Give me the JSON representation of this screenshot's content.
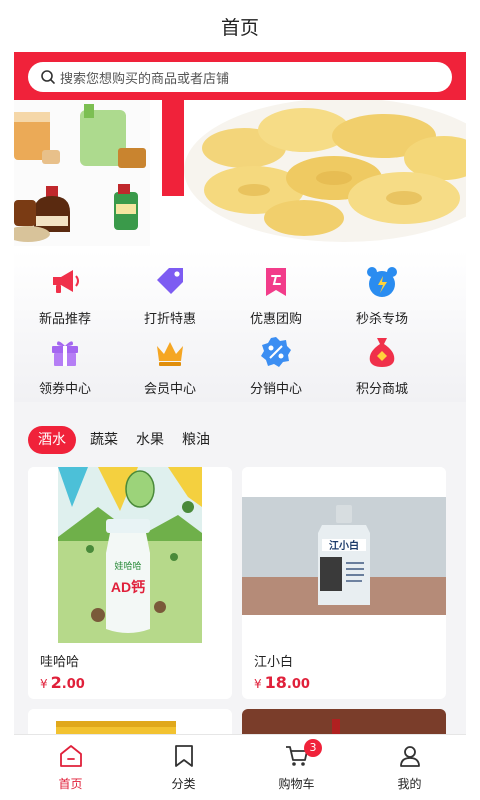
{
  "header": {
    "title": "首页"
  },
  "search": {
    "placeholder": "搜索您想购买的商品或者店铺"
  },
  "menu": [
    {
      "label": "新品推荐",
      "icon": "megaphone-icon",
      "color": "#f0304a"
    },
    {
      "label": "打折特惠",
      "icon": "price-tag-icon",
      "color": "#7d5cf2"
    },
    {
      "label": "优惠团购",
      "icon": "group-buy-icon",
      "color": "#f23c8a"
    },
    {
      "label": "秒杀专场",
      "icon": "alarm-clock-icon",
      "color": "#2a8cf0"
    },
    {
      "label": "领券中心",
      "icon": "gift-icon",
      "color": "#a466f0"
    },
    {
      "label": "会员中心",
      "icon": "crown-icon",
      "color": "#f5a623"
    },
    {
      "label": "分销中心",
      "icon": "discount-icon",
      "color": "#3c8ef2"
    },
    {
      "label": "积分商城",
      "icon": "money-bag-icon",
      "color": "#f0304a"
    }
  ],
  "category_tabs": [
    {
      "label": "酒水",
      "active": true
    },
    {
      "label": "蔬菜",
      "active": false
    },
    {
      "label": "水果",
      "active": false
    },
    {
      "label": "粮油",
      "active": false
    }
  ],
  "products": [
    {
      "name": "哇哈哈",
      "currency": "¥",
      "price_int": "2",
      "price_dec": ".00",
      "image_text": "娃哈哈",
      "image_label": "AD钙"
    },
    {
      "name": "江小白",
      "currency": "¥",
      "price_int": "18",
      "price_dec": ".00",
      "image_text": "江小白",
      "image_label": ""
    }
  ],
  "tabbar": [
    {
      "label": "首页",
      "icon": "home-icon",
      "active": true
    },
    {
      "label": "分类",
      "icon": "bookmark-icon",
      "active": false
    },
    {
      "label": "购物车",
      "icon": "cart-icon",
      "active": false,
      "badge": "3"
    },
    {
      "label": "我的",
      "icon": "user-icon",
      "active": false
    }
  ],
  "colors": {
    "accent": "#f0223a",
    "price": "#e0203a",
    "background": "#f4f4f6"
  }
}
